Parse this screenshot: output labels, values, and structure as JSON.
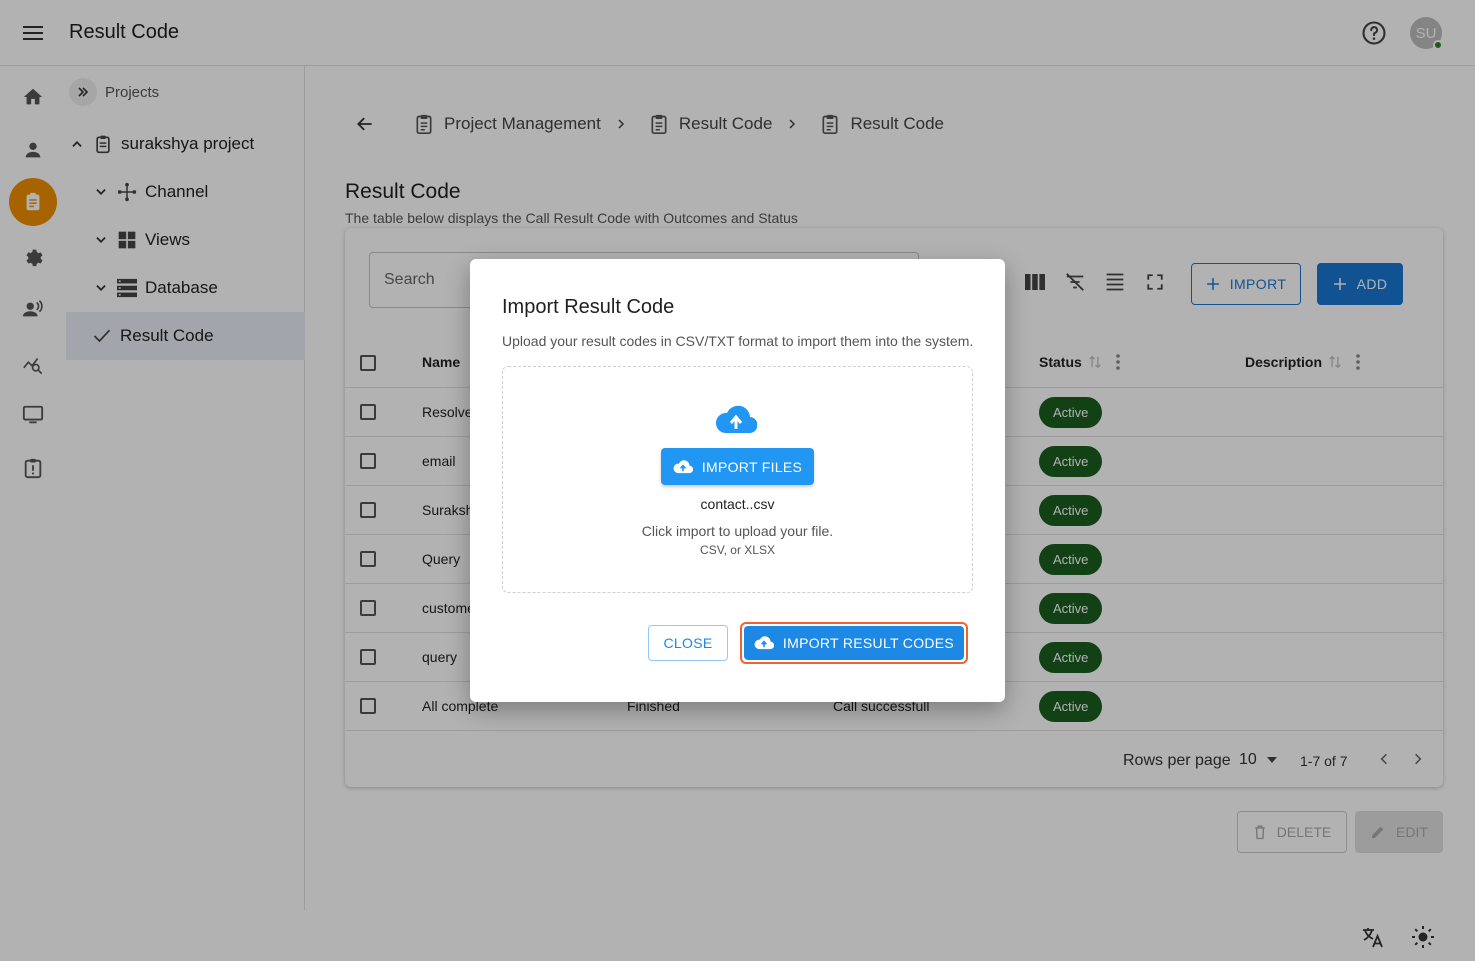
{
  "header": {
    "title": "Result Code",
    "avatar_initials": "SU"
  },
  "rail": {
    "items": [
      "home-icon",
      "person-icon",
      "clipboard-icon",
      "gear-icon",
      "agent-voice-icon",
      "analytics-icon",
      "monitor-icon",
      "report-icon"
    ],
    "active": "clipboard-icon",
    "accent": "#ef8f00"
  },
  "tree": {
    "projects_label": "Projects",
    "project": "surakshya project",
    "items": [
      {
        "label": "Channel"
      },
      {
        "label": "Views"
      },
      {
        "label": "Database"
      },
      {
        "label": "Result Code"
      }
    ]
  },
  "breadcrumbs": [
    "Project Management",
    "Result Code",
    "Result Code"
  ],
  "page": {
    "title": "Result Code",
    "subtitle": "The table below displays the Call Result Code with Outcomes and Status"
  },
  "toolbar": {
    "search_placeholder": "Search",
    "import_label": "IMPORT",
    "add_label": "ADD"
  },
  "table": {
    "columns": {
      "name": "Name",
      "status": "Status",
      "description": "Description"
    },
    "rows": [
      {
        "name": "Resolve",
        "outcome": "",
        "detail": "",
        "status": "Active"
      },
      {
        "name": "email",
        "outcome": "",
        "detail": "",
        "status": "Active"
      },
      {
        "name": "Suraksh",
        "outcome": "",
        "detail": "",
        "status": "Active"
      },
      {
        "name": "Query",
        "outcome": "",
        "detail": "",
        "status": "Active"
      },
      {
        "name": "custome",
        "outcome": "",
        "detail": "",
        "status": "Active"
      },
      {
        "name": "query",
        "outcome": "",
        "detail": "",
        "status": "Active"
      },
      {
        "name": "All complete",
        "outcome": "Finished",
        "detail": "Call successfull",
        "status": "Active"
      }
    ],
    "rows_per_page_label": "Rows per page",
    "rows_per_page": "10",
    "range": "1-7 of 7"
  },
  "actions": {
    "delete_label": "DELETE",
    "edit_label": "EDIT"
  },
  "modal": {
    "title": "Import Result Code",
    "description": "Upload your result codes in CSV/TXT format to import them into the system.",
    "files_button": "IMPORT FILES",
    "file_name": "contact..csv",
    "hint": "Click import to upload your file.",
    "formats": "CSV, or XLSX",
    "close_label": "CLOSE",
    "submit_label": "IMPORT RESULT CODES"
  },
  "colors": {
    "primary": "#1976d2",
    "status_active": "#1b5e20",
    "focus_ring": "#f0632e"
  }
}
